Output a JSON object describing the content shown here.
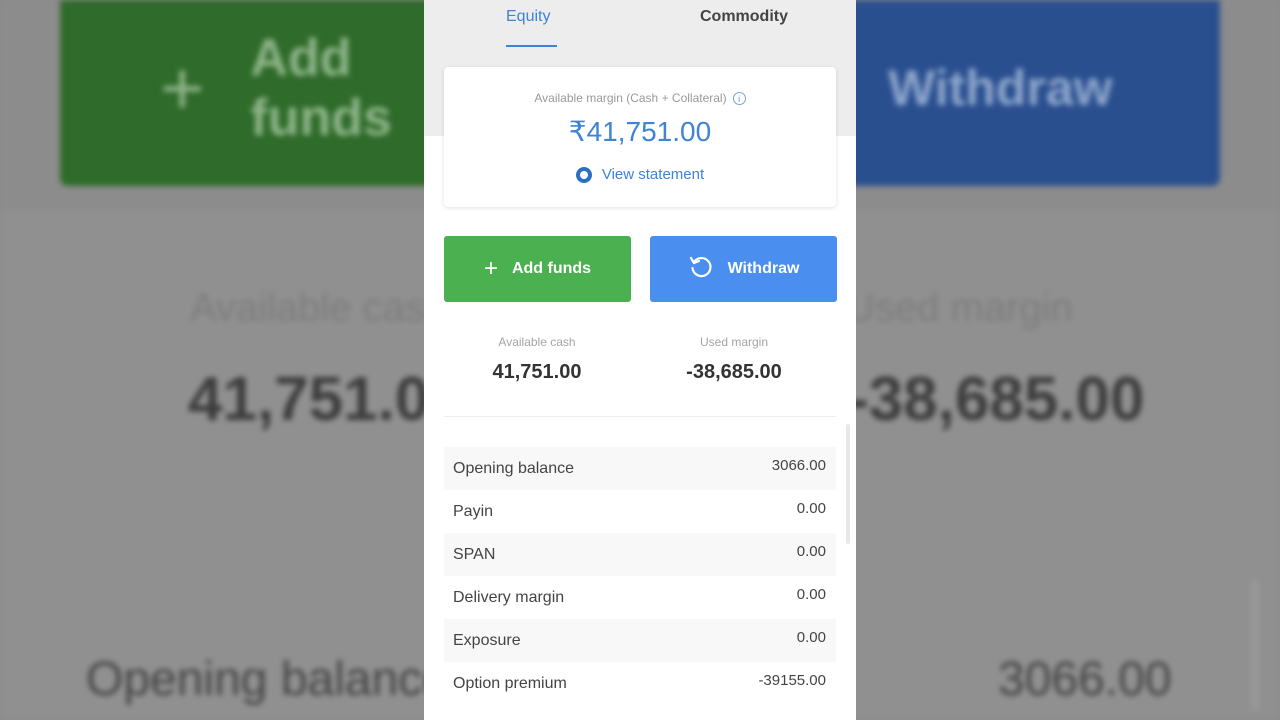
{
  "tabs": [
    {
      "label": "Equity",
      "active": true
    },
    {
      "label": "Commodity",
      "active": false
    }
  ],
  "margin": {
    "label": "Available margin (Cash + Collateral)",
    "value": "₹41,751.00",
    "view_statement": "View statement"
  },
  "actions": {
    "add_funds": "Add funds",
    "withdraw": "Withdraw"
  },
  "summary": {
    "available_cash_label": "Available cash",
    "available_cash_value": "41,751.00",
    "used_margin_label": "Used margin",
    "used_margin_value": "-38,685.00"
  },
  "rows": [
    {
      "label": "Opening balance",
      "value": "3066.00"
    },
    {
      "label": "Payin",
      "value": "0.00"
    },
    {
      "label": "SPAN",
      "value": "0.00"
    },
    {
      "label": "Delivery margin",
      "value": "0.00"
    },
    {
      "label": "Exposure",
      "value": "0.00"
    },
    {
      "label": "Option premium",
      "value": "-39155.00"
    }
  ],
  "background": {
    "add_funds": "Add funds",
    "withdraw": "Withdraw",
    "available_cash_label": "Available cash",
    "used_margin_label": "Used margin",
    "available_cash_value": "41,751.00",
    "used_margin_value": "-38,685.00",
    "opening_balance_label": "Opening balance",
    "opening_balance_value": "3066.00"
  },
  "colors": {
    "accent": "#3e83d6",
    "add_funds_bg": "#4bb04f",
    "withdraw_bg": "#4a8ff0"
  }
}
